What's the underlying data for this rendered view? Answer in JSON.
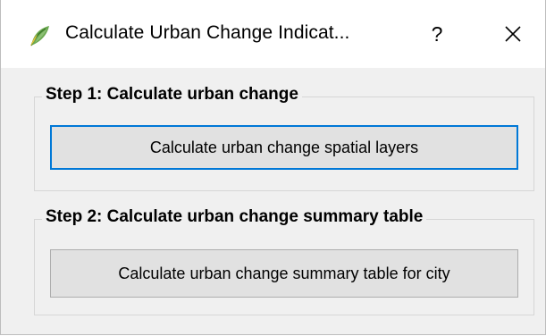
{
  "window": {
    "title": "Calculate Urban Change Indicat...",
    "help_label": "?",
    "app_icon": "qgis-leaf-icon",
    "close_icon": "close-icon"
  },
  "step1": {
    "group_title": "Step 1: Calculate urban change",
    "button_label": "Calculate urban change spatial layers"
  },
  "step2": {
    "group_title": "Step 2: Calculate urban change summary table",
    "button_label": "Calculate urban change summary table for city"
  },
  "colors": {
    "focus_border": "#0078d7",
    "dialog_bg": "#f0f0f0",
    "button_bg": "#e1e1e1",
    "icon_green": "#6aa84f",
    "icon_yellow": "#e8c33a"
  }
}
